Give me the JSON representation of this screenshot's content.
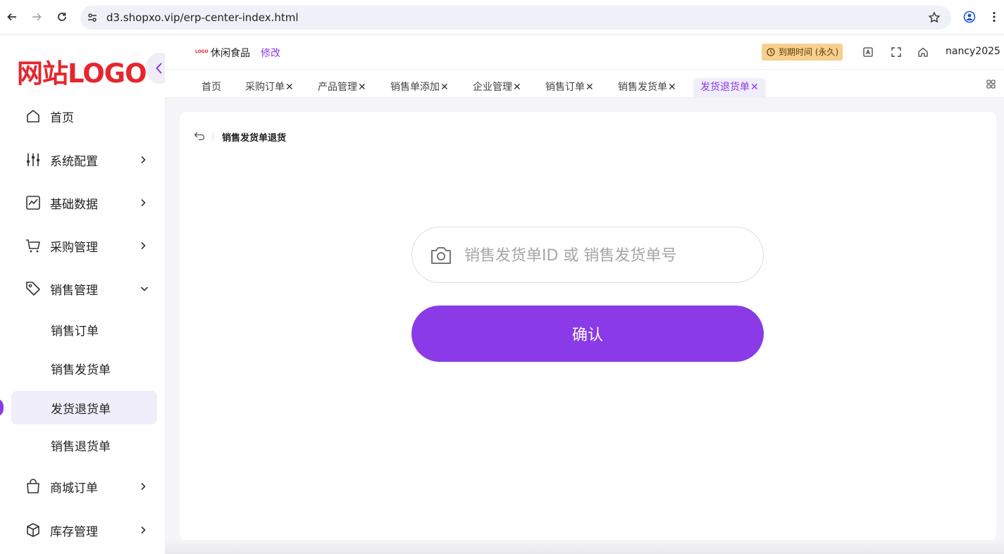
{
  "browser": {
    "url": "d3.shopxo.vip/erp-center-index.html"
  },
  "sidebar": {
    "logo": "网站LOGO",
    "items": [
      {
        "label": "首页",
        "icon": "home-icon"
      },
      {
        "label": "系统配置",
        "icon": "sliders-icon"
      },
      {
        "label": "基础数据",
        "icon": "chart-icon"
      },
      {
        "label": "采购管理",
        "icon": "cart-icon"
      },
      {
        "label": "销售管理",
        "icon": "tag-icon"
      }
    ],
    "sub_items": [
      {
        "label": "销售订单"
      },
      {
        "label": "销售发货单"
      },
      {
        "label": "发货退货单"
      },
      {
        "label": "销售退货单"
      }
    ],
    "items_after": [
      {
        "label": "商城订单",
        "icon": "bag-icon"
      },
      {
        "label": "库存管理",
        "icon": "box-icon"
      }
    ]
  },
  "header": {
    "mini_logo": "LOGO",
    "shop_name": "休闲食品",
    "edit_label": "修改",
    "expire_label": "到期时间 (永久)",
    "username": "nancy2025"
  },
  "tabs": [
    {
      "label": "首页",
      "closable": false
    },
    {
      "label": "采购订单",
      "closable": true
    },
    {
      "label": "产品管理",
      "closable": true
    },
    {
      "label": "销售单添加",
      "closable": true
    },
    {
      "label": "企业管理",
      "closable": true
    },
    {
      "label": "销售订单",
      "closable": true
    },
    {
      "label": "销售发货单",
      "closable": true
    },
    {
      "label": "发货退货单",
      "closable": true,
      "active": true
    }
  ],
  "main": {
    "title": "销售发货单退货",
    "search_placeholder": "销售发货单ID 或 销售发货单号",
    "confirm_label": "确认"
  },
  "colors": {
    "accent": "#8a3ae6",
    "logo_red": "#e6262e",
    "badge": "#f7cf8f"
  }
}
